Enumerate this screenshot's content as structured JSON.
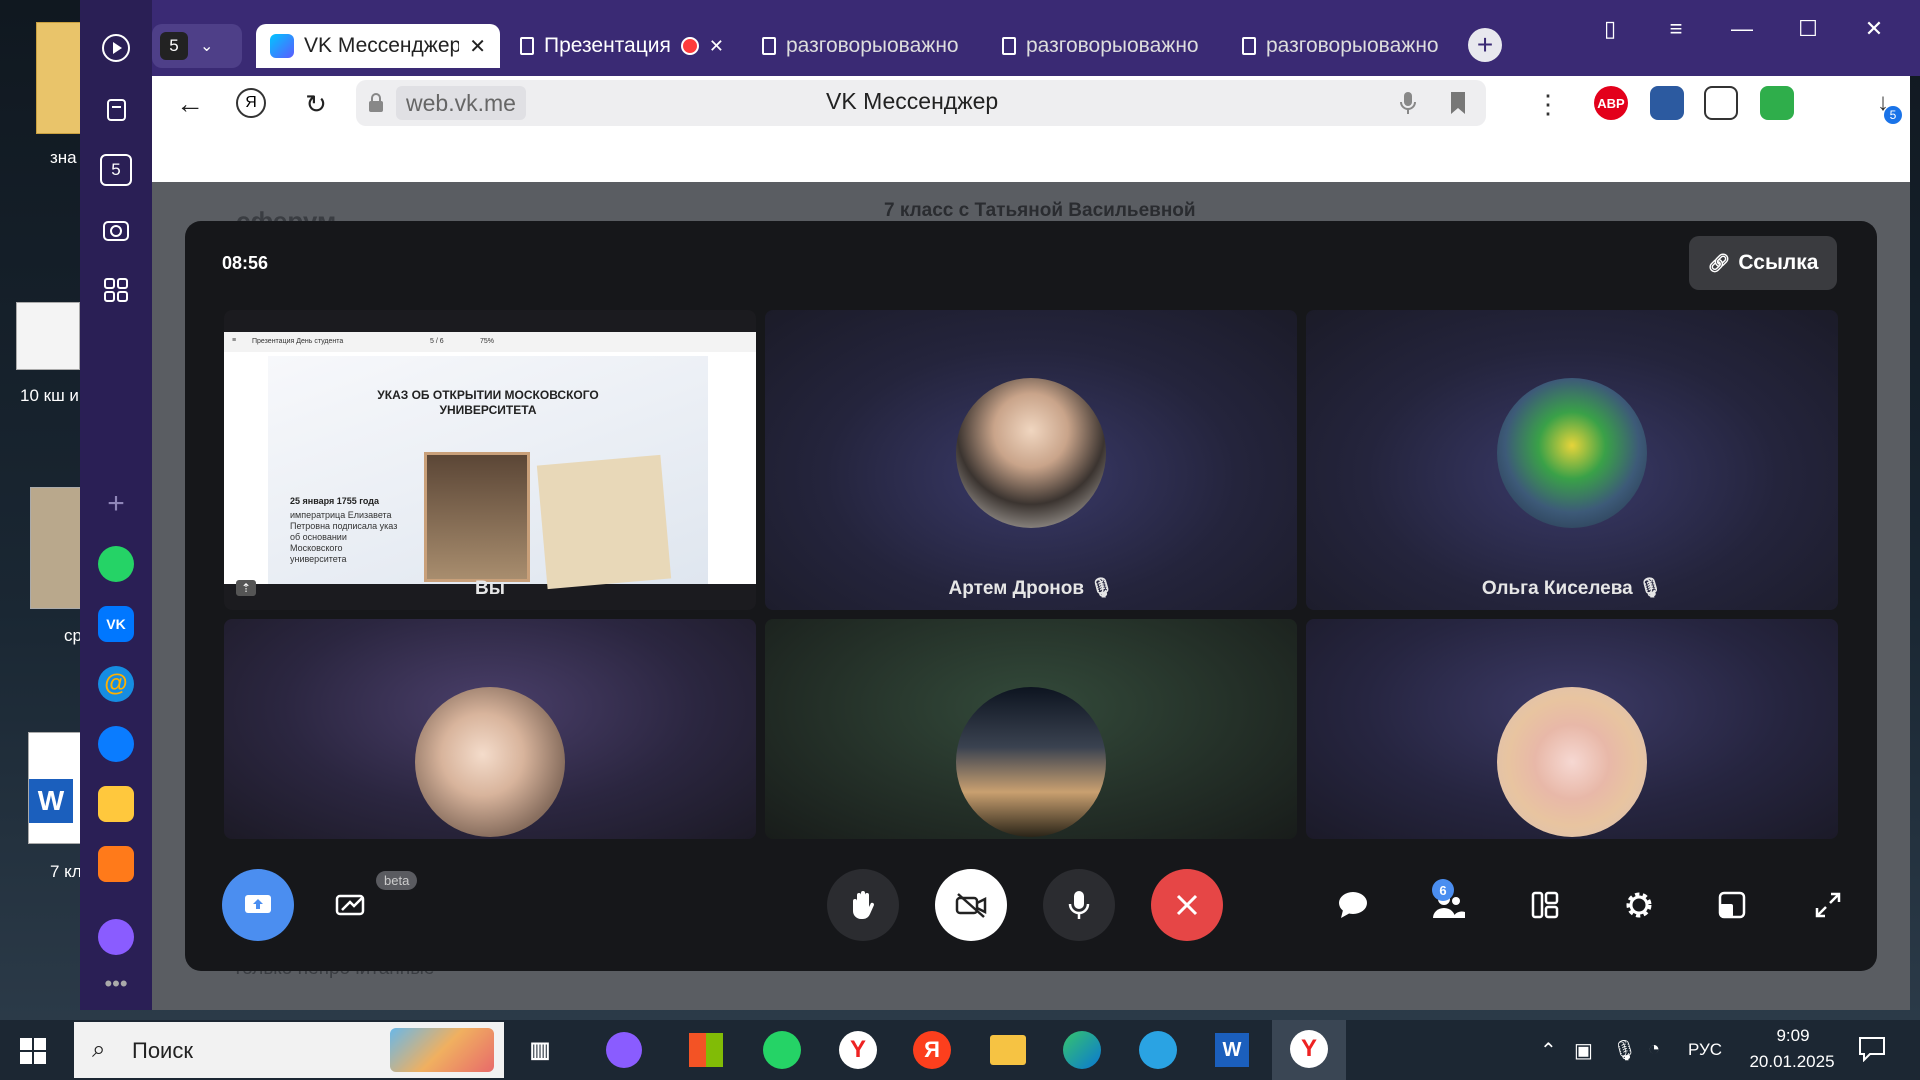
{
  "desktop": {
    "icons": [
      {
        "label": "зна"
      },
      {
        "label": "10 кш и"
      },
      {
        "label": "ср"
      },
      {
        "label": "7 кл"
      }
    ]
  },
  "sidebar": {
    "badge": "5"
  },
  "tabs": {
    "group_count": "5",
    "items": [
      {
        "label": "VK Мессенджер"
      },
      {
        "label": "Презентация"
      },
      {
        "label": "разговорыоважном"
      },
      {
        "label": "разговорыоважном"
      },
      {
        "label": "разговорыоважном"
      }
    ]
  },
  "address": {
    "url": "web.vk.me",
    "page_title": "VK Мессенджер",
    "abp_label": "ABP",
    "downloads_badge": "5"
  },
  "vk_background": {
    "brand": "сферум",
    "chat_title": "7 класс с Татьяной Васильевной",
    "filter_label": "Только непрочитанные"
  },
  "call": {
    "timer": "08:56",
    "link_button": "Ссылка",
    "participants": [
      {
        "name": "Вы",
        "muted": false
      },
      {
        "name": "Артем Дронов",
        "muted": true
      },
      {
        "name": "Ольга Киселева",
        "muted": true
      },
      {
        "name": "",
        "muted": false
      },
      {
        "name": "",
        "muted": false
      },
      {
        "name": "",
        "muted": false
      }
    ],
    "shared_slide": {
      "toolbar_title": "Презентация День студента",
      "page": "5 / 6",
      "zoom": "75%",
      "heading": "УКАЗ ОБ ОТКРЫТИИ МОСКОВСКОГО УНИВЕРСИТЕТА",
      "date": "25 января 1755 года",
      "text": "императрица Елизавета Петровна подписала указ об основании Московского университета"
    },
    "controls": {
      "beta_label": "beta",
      "participants_count": "6"
    }
  },
  "taskbar": {
    "search_placeholder": "Поиск",
    "lang": "РУС",
    "time": "9:09",
    "date": "20.01.2025"
  }
}
